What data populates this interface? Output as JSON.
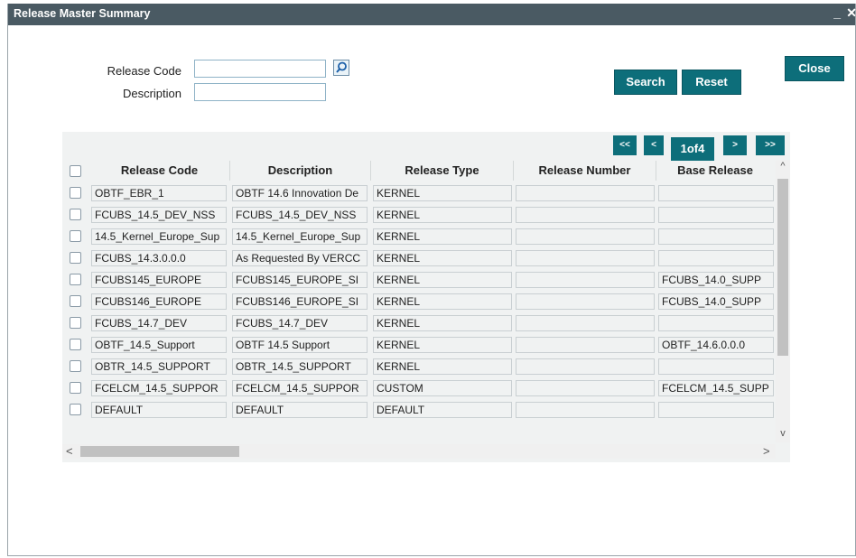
{
  "window": {
    "title": "Release Master Summary",
    "minimize": "_",
    "close": "✕"
  },
  "form": {
    "release_code_label": "Release Code",
    "release_code_value": "",
    "description_label": "Description",
    "description_value": ""
  },
  "buttons": {
    "search": "Search",
    "reset": "Reset",
    "close": "Close"
  },
  "pager": {
    "first": "<<",
    "prev": "<",
    "page": "1of4",
    "next": ">",
    "last": ">>"
  },
  "table": {
    "columns": [
      "Release Code",
      "Description",
      "Release Type",
      "Release Number",
      "Base Release"
    ],
    "rows": [
      [
        "OBTF_EBR_1",
        "OBTF 14.6 Innovation De",
        "KERNEL",
        "",
        ""
      ],
      [
        "FCUBS_14.5_DEV_NSS",
        "FCUBS_14.5_DEV_NSS",
        "KERNEL",
        "",
        ""
      ],
      [
        "14.5_Kernel_Europe_Sup",
        "14.5_Kernel_Europe_Sup",
        "KERNEL",
        "",
        ""
      ],
      [
        "FCUBS_14.3.0.0.0",
        "As Requested By VERCC",
        "KERNEL",
        "",
        ""
      ],
      [
        "FCUBS145_EUROPE",
        "FCUBS145_EUROPE_SI",
        "KERNEL",
        "",
        "FCUBS_14.0_SUPP"
      ],
      [
        "FCUBS146_EUROPE",
        "FCUBS146_EUROPE_SI",
        "KERNEL",
        "",
        "FCUBS_14.0_SUPP"
      ],
      [
        "FCUBS_14.7_DEV",
        "FCUBS_14.7_DEV",
        "KERNEL",
        "",
        ""
      ],
      [
        "OBTF_14.5_Support",
        "OBTF 14.5 Support",
        "KERNEL",
        "",
        "OBTF_14.6.0.0.0"
      ],
      [
        "OBTR_14.5_SUPPORT",
        "OBTR_14.5_SUPPORT",
        "KERNEL",
        "",
        ""
      ],
      [
        "FCELCM_14.5_SUPPOR",
        "FCELCM_14.5_SUPPOR",
        "CUSTOM",
        "",
        "FCELCM_14.5_SUPP"
      ],
      [
        "DEFAULT",
        "DEFAULT",
        "DEFAULT",
        "",
        ""
      ]
    ]
  },
  "scroll": {
    "up": "^",
    "down": "v",
    "left": "<",
    "right": ">"
  },
  "colors": {
    "titlebar": "#4a5a63",
    "button": "#0d6e7a",
    "field_border": "#8fb3c7"
  }
}
